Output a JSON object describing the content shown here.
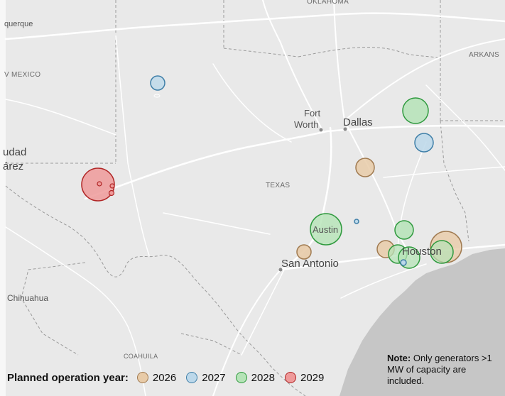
{
  "labels": {
    "oklahoma": "OKLAHOMA",
    "albuquerque": "querque",
    "new_mexico": "V MEXICO",
    "arkansas": "ARKANS",
    "fort_worth_1": "Fort",
    "fort_worth_2": "Worth",
    "dallas": "Dallas",
    "ciudad_1": "udad",
    "ciudad_2": "árez",
    "texas": "TEXAS",
    "austin": "Austin",
    "houston": "Houston",
    "san_antonio": "San Antonio",
    "chihuahua": "Chihuahua",
    "coahuila": "COAHUILA"
  },
  "legend": {
    "title": "Planned operation year:",
    "items": [
      {
        "label": "2026",
        "fill": "#e8cba8",
        "stroke": "#a07a50"
      },
      {
        "label": "2027",
        "fill": "#bcd8ea",
        "stroke": "#3f7fa8"
      },
      {
        "label": "2028",
        "fill": "#b5e3b7",
        "stroke": "#2f9a3e"
      },
      {
        "label": "2029",
        "fill": "#ef9a9a",
        "stroke": "#b02525"
      }
    ]
  },
  "note": {
    "bold": "Note:",
    "text": " Only generators >1 MW of capacity are included."
  },
  "colors": {
    "background": "#e9e9e9",
    "road": "#ffffff",
    "border": "#9a9a9a",
    "gulf": "#c8c8c8"
  },
  "generators": [
    {
      "year": "2027",
      "size": "small",
      "location": "southeast New Mexico"
    },
    {
      "year": "2029",
      "size": "large",
      "location": "west Texas"
    },
    {
      "year": "2029",
      "size": "tiny",
      "location": "west Texas"
    },
    {
      "year": "2029",
      "size": "tiny",
      "location": "west Texas"
    },
    {
      "year": "2029",
      "size": "tiny",
      "location": "west Texas"
    },
    {
      "year": "2028",
      "size": "medium",
      "location": "northeast Texas"
    },
    {
      "year": "2027",
      "size": "small",
      "location": "east Texas"
    },
    {
      "year": "2026",
      "size": "small",
      "location": "central Texas"
    },
    {
      "year": "2028",
      "size": "large",
      "location": "Austin"
    },
    {
      "year": "2027",
      "size": "tiny",
      "location": "east of Austin"
    },
    {
      "year": "2026",
      "size": "small",
      "location": "south of Austin"
    },
    {
      "year": "2028",
      "size": "small",
      "location": "north of Houston"
    },
    {
      "year": "2026",
      "size": "small",
      "location": "west Houston"
    },
    {
      "year": "2028",
      "size": "small",
      "location": "Houston"
    },
    {
      "year": "2028",
      "size": "medium",
      "location": "south Houston"
    },
    {
      "year": "2027",
      "size": "tiny",
      "location": "south Houston"
    },
    {
      "year": "2026",
      "size": "large",
      "location": "east Houston"
    },
    {
      "year": "2028",
      "size": "medium",
      "location": "east Houston"
    }
  ]
}
